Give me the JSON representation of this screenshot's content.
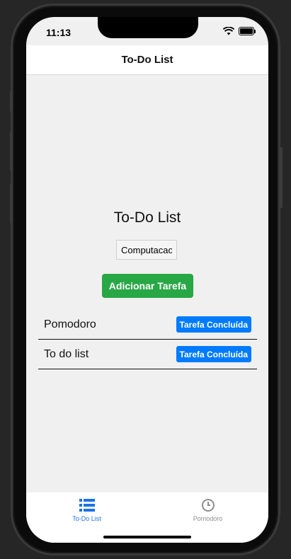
{
  "status": {
    "time": "11:13"
  },
  "nav": {
    "title": "To-Do List"
  },
  "main": {
    "title": "To-Do List",
    "input_value": "Computacao",
    "add_button": "Adicionar Tarefa"
  },
  "tasks": [
    {
      "name": "Pomodoro",
      "button": "Tarefa Concluída"
    },
    {
      "name": "To do list",
      "button": "Tarefa Concluída"
    }
  ],
  "tabbar": {
    "tabs": [
      {
        "label": "To-Do List",
        "icon": "list-icon",
        "active": true
      },
      {
        "label": "Pomodoro",
        "icon": "clock-icon",
        "active": false
      }
    ]
  },
  "colors": {
    "accent": "#1a73e8",
    "add": "#28a745",
    "done": "#007bff"
  }
}
